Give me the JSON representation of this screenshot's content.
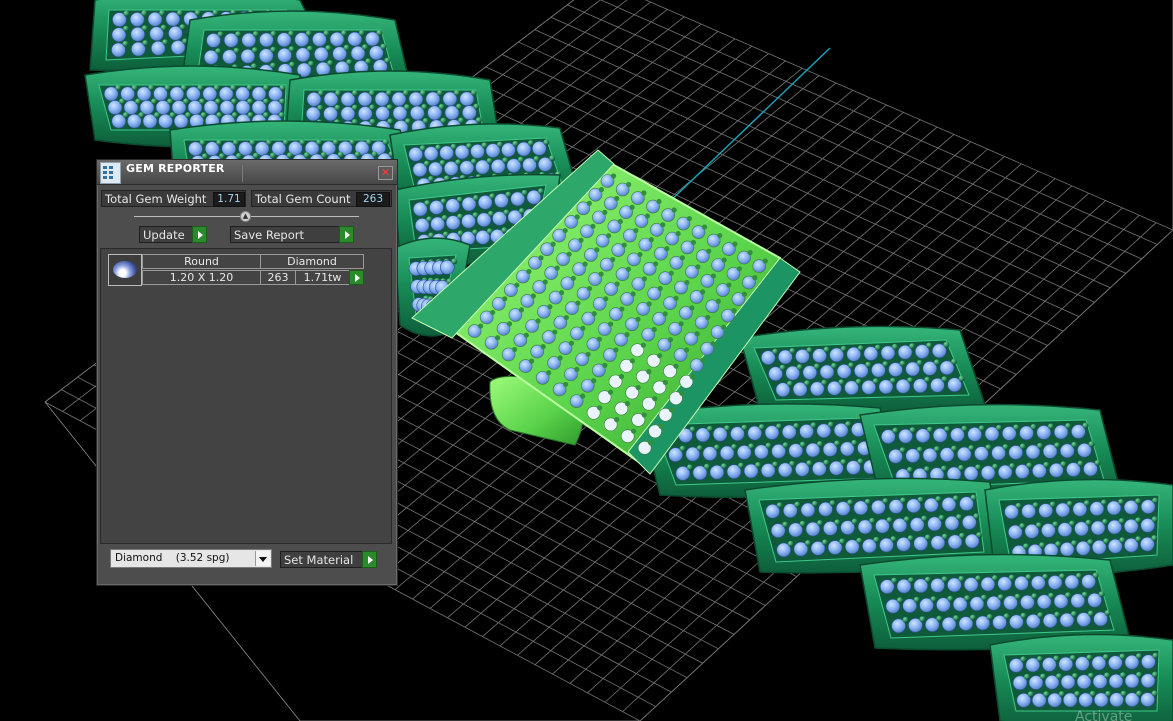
{
  "window": {
    "title": "GEM REPORTER",
    "icon": "gem-reporter-icon",
    "close_icon": "close-icon"
  },
  "stats": {
    "total_gem_weight_label": "Total Gem Weight",
    "total_gem_weight_value": "1.71",
    "total_gem_count_label": "Total Gem Count",
    "total_gem_count_value": "263"
  },
  "toolbar": {
    "update_label": "Update",
    "save_report_label": "Save Report"
  },
  "gem_table": {
    "rows": [
      {
        "thumbnail": "round-diamond-icon",
        "shape": "Round",
        "material": "Diamond",
        "size": "1.20 X 1.20",
        "count": "263",
        "weight": "1.71tw"
      }
    ]
  },
  "material_select": {
    "selected": "Diamond    (3.52 spg)"
  },
  "set_material_label": "Set Material",
  "watermark": "Activate",
  "colors": {
    "panel_bg": "#4d4d4d",
    "accent_green": "#2b8a2b",
    "value_text": "#9fd2f2",
    "metal_green": "#1f8a5a",
    "selected_link": "#7ee05a",
    "gem_blue": "#8fb8f5"
  }
}
